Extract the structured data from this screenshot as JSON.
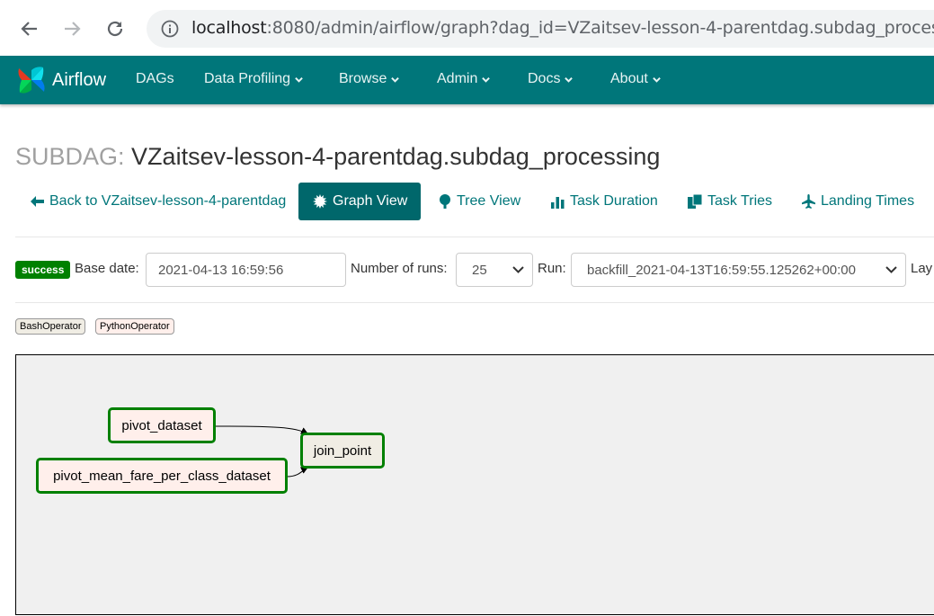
{
  "browser": {
    "url_host": "localhost",
    "url_rest": ":8080/admin/airflow/graph?dag_id=VZaitsev-lesson-4-parentdag.subdag_proces",
    "back_icon": "arrow-left-icon",
    "forward_icon": "arrow-right-icon",
    "reload_icon": "reload-icon",
    "info_icon": "info-icon"
  },
  "navbar": {
    "brand": "Airflow",
    "items": [
      {
        "label": "DAGs",
        "dropdown": false
      },
      {
        "label": "Data Profiling",
        "dropdown": true
      },
      {
        "label": "Browse",
        "dropdown": true
      },
      {
        "label": "Admin",
        "dropdown": true
      },
      {
        "label": "Docs",
        "dropdown": true
      },
      {
        "label": "About",
        "dropdown": true
      }
    ],
    "color": "#00767a"
  },
  "page": {
    "title_prefix": "SUBDAG:",
    "title": "VZaitsev-lesson-4-parentdag.subdag_processing"
  },
  "tabs": [
    {
      "label": "Back to VZaitsev-lesson-4-parentdag",
      "icon": "arrow-left-icon",
      "active": false
    },
    {
      "label": "Graph View",
      "icon": "asterisk-icon",
      "active": true
    },
    {
      "label": "Tree View",
      "icon": "tree-icon",
      "active": false
    },
    {
      "label": "Task Duration",
      "icon": "bar-chart-icon",
      "active": false
    },
    {
      "label": "Task Tries",
      "icon": "copy-icon",
      "active": false
    },
    {
      "label": "Landing Times",
      "icon": "plane-icon",
      "active": false
    }
  ],
  "form": {
    "state_badge": "success",
    "base_date_label": "Base date:",
    "base_date_value": "2021-04-13 16:59:56",
    "num_runs_label": "Number of runs:",
    "num_runs_value": "25",
    "run_label": "Run:",
    "run_value": "backfill_2021-04-13T16:59:55.125262+00:00",
    "layout_label": "Lay"
  },
  "legend": {
    "operators": [
      {
        "label": "BashOperator",
        "color": "#f0ede4"
      },
      {
        "label": "PythonOperator",
        "color": "#ffefeb"
      }
    ]
  },
  "graph": {
    "nodes": [
      {
        "id": "pivot_dataset",
        "label": "pivot_dataset",
        "operator": "PythonOperator",
        "state": "success"
      },
      {
        "id": "pivot_mean_fare_per_class_dataset",
        "label": "pivot_mean_fare_per_class_dataset",
        "operator": "PythonOperator",
        "state": "success"
      },
      {
        "id": "join_point",
        "label": "join_point",
        "operator": "BashOperator",
        "state": "success"
      }
    ],
    "edges": [
      {
        "from": "pivot_dataset",
        "to": "join_point"
      },
      {
        "from": "pivot_mean_fare_per_class_dataset",
        "to": "join_point"
      }
    ],
    "success_color": "#008000"
  }
}
